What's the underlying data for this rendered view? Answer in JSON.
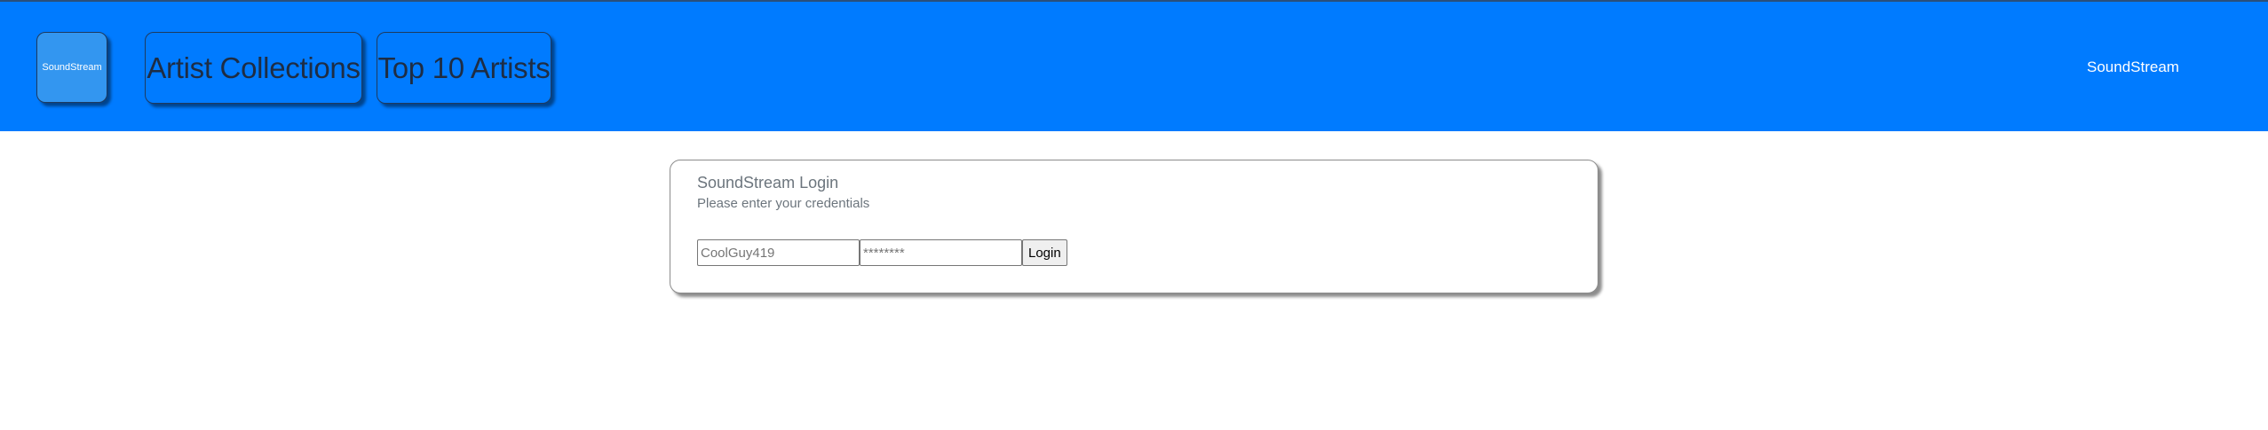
{
  "header": {
    "logo_label": "SoundStream",
    "nav": [
      {
        "label": "Artist Collections"
      },
      {
        "label": "Top 10 Artists"
      }
    ],
    "brand_right": "SoundStream"
  },
  "login": {
    "title": "SoundStream Login",
    "subtitle": "Please enter your credentials",
    "username_placeholder": "CoolGuy419",
    "password_placeholder": "********",
    "button_label": "Login"
  },
  "colors": {
    "header_bg": "#007bff",
    "text_muted": "#6c757d"
  }
}
